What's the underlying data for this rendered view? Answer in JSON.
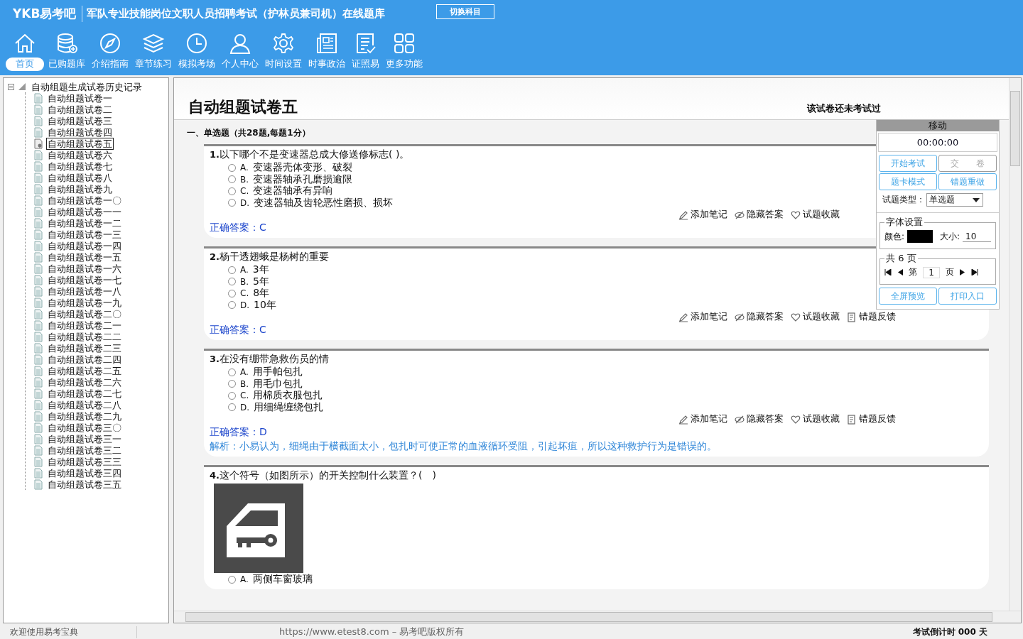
{
  "header": {
    "logo": "YKB易考吧",
    "title": "军队专业技能岗位文职人员招聘考试（护林员兼司机）在线题库",
    "switch_button": "切换科目"
  },
  "toolbar": [
    {
      "label": "首页",
      "selected": true
    },
    {
      "label": "已购题库",
      "selected": false
    },
    {
      "label": "介绍指南",
      "selected": false
    },
    {
      "label": "章节练习",
      "selected": false
    },
    {
      "label": "模拟考场",
      "selected": false
    },
    {
      "label": "个人中心",
      "selected": false
    },
    {
      "label": "时间设置",
      "selected": false
    },
    {
      "label": "时事政治",
      "selected": false
    },
    {
      "label": "证照易",
      "selected": false
    },
    {
      "label": "更多功能",
      "selected": false
    }
  ],
  "tree": {
    "label": "自动组题生成试卷历史记录",
    "expanded": true,
    "children": [
      {
        "label": "自动组题试卷一",
        "selected": false
      },
      {
        "label": "自动组题试卷二",
        "selected": false
      },
      {
        "label": "自动组题试卷三",
        "selected": false
      },
      {
        "label": "自动组题试卷四",
        "selected": false
      },
      {
        "label": "自动组题试卷五",
        "selected": true
      },
      {
        "label": "自动组题试卷六",
        "selected": false
      },
      {
        "label": "自动组题试卷七",
        "selected": false
      },
      {
        "label": "自动组题试卷八",
        "selected": false
      },
      {
        "label": "自动组题试卷九",
        "selected": false
      },
      {
        "label": "自动组题试卷一〇",
        "selected": false
      },
      {
        "label": "自动组题试卷一一",
        "selected": false
      },
      {
        "label": "自动组题试卷一二",
        "selected": false
      },
      {
        "label": "自动组题试卷一三",
        "selected": false
      },
      {
        "label": "自动组题试卷一四",
        "selected": false
      },
      {
        "label": "自动组题试卷一五",
        "selected": false
      },
      {
        "label": "自动组题试卷一六",
        "selected": false
      },
      {
        "label": "自动组题试卷一七",
        "selected": false
      },
      {
        "label": "自动组题试卷一八",
        "selected": false
      },
      {
        "label": "自动组题试卷一九",
        "selected": false
      },
      {
        "label": "自动组题试卷二〇",
        "selected": false
      },
      {
        "label": "自动组题试卷二一",
        "selected": false
      },
      {
        "label": "自动组题试卷二二",
        "selected": false
      },
      {
        "label": "自动组题试卷二三",
        "selected": false
      },
      {
        "label": "自动组题试卷二四",
        "selected": false
      },
      {
        "label": "自动组题试卷二五",
        "selected": false
      },
      {
        "label": "自动组题试卷二六",
        "selected": false
      },
      {
        "label": "自动组题试卷二七",
        "selected": false
      },
      {
        "label": "自动组题试卷二八",
        "selected": false
      },
      {
        "label": "自动组题试卷二九",
        "selected": false
      },
      {
        "label": "自动组题试卷三〇",
        "selected": false
      },
      {
        "label": "自动组题试卷三一",
        "selected": false
      },
      {
        "label": "自动组题试卷三二",
        "selected": false
      },
      {
        "label": "自动组题试卷三三",
        "selected": false
      },
      {
        "label": "自动组题试卷三四",
        "selected": false
      },
      {
        "label": "自动组题试卷三五",
        "selected": false
      }
    ]
  },
  "exam": {
    "title": "自动组题试卷五",
    "status": "该试卷还未考试过",
    "section": "一、单选题（共28题,每题1分）",
    "questions": [
      {
        "number": "1.",
        "kind": "plain",
        "text": "以下哪个不是变速器总成大修送修标志( )。",
        "options": [
          {
            "label": "A.",
            "text": "变速器壳体变形、破裂",
            "selected": false
          },
          {
            "label": "B.",
            "text": "变速器轴承孔磨损逾限",
            "selected": false
          },
          {
            "label": "C.",
            "text": "变速器轴承有异响",
            "selected": false
          },
          {
            "label": "D.",
            "text": "变速器轴及齿轮恶性磨损、损坏",
            "selected": false
          }
        ],
        "actions": [
          {
            "kind": "note",
            "label": "添加笔记"
          },
          {
            "kind": "hide",
            "label": "隐藏答案"
          },
          {
            "kind": "favorite",
            "label": "试题收藏"
          }
        ],
        "answer_label": "正确答案：",
        "answer": "C"
      },
      {
        "number": "2.",
        "kind": "plain",
        "text": "杨干透翅蛾是杨树的重要",
        "options": [
          {
            "label": "A.",
            "text": "3年",
            "selected": false
          },
          {
            "label": "B.",
            "text": "5年",
            "selected": false
          },
          {
            "label": "C.",
            "text": "8年",
            "selected": false
          },
          {
            "label": "D.",
            "text": "10年",
            "selected": false
          }
        ],
        "actions": [
          {
            "kind": "note",
            "label": "添加笔记"
          },
          {
            "kind": "hide",
            "label": "隐藏答案"
          },
          {
            "kind": "favorite",
            "label": "试题收藏"
          },
          {
            "kind": "report",
            "label": "错题反馈"
          }
        ],
        "answer_label": "正确答案：",
        "answer": "C"
      },
      {
        "number": "3.",
        "kind": "plain",
        "text": "在没有绷带急救伤员的情",
        "options": [
          {
            "label": "A.",
            "text": "用手帕包扎",
            "selected": false
          },
          {
            "label": "B.",
            "text": "用毛巾包扎",
            "selected": false
          },
          {
            "label": "C.",
            "text": "用棉质衣服包扎",
            "selected": false
          },
          {
            "label": "D.",
            "text": "用细绳缠绕包扎",
            "selected": false
          }
        ],
        "actions": [
          {
            "kind": "note",
            "label": "添加笔记"
          },
          {
            "kind": "hide",
            "label": "隐藏答案"
          },
          {
            "kind": "favorite",
            "label": "试题收藏"
          },
          {
            "kind": "report",
            "label": "错题反馈"
          }
        ],
        "answer_label": "正确答案：",
        "answer": "D",
        "analysis": "解析：小易认为，细绳由于横截面太小，包扎时可使正常的血液循环受阻，引起坏疽，所以这种救护行为是错误的。"
      },
      {
        "number": "4.",
        "text": "这个符号（如图所示）的开关控制什么装置？(　)",
        "kind": "picture",
        "options": [
          {
            "label": "A.",
            "text": "两侧车窗玻璃",
            "selected": false
          }
        ]
      }
    ]
  },
  "panel": {
    "title": "移动",
    "timer": "00:00:00",
    "buttons": [
      {
        "label": "开始考试",
        "disabled": false
      },
      {
        "label": "交　　卷",
        "disabled": true
      },
      {
        "label": "题卡模式",
        "disabled": false
      },
      {
        "label": "错题重做",
        "disabled": false
      }
    ],
    "type_label": "试题类型：",
    "type_value": "单选题",
    "font_group": "字体设置",
    "color_label": "颜色:",
    "color": "#000000",
    "size_label": "大小:",
    "size": "10",
    "pages_group": "共 6 页",
    "page_prefix": "第",
    "page": "1",
    "page_suffix": "页",
    "bottom_buttons": [
      "全屏预览",
      "打印入口"
    ]
  },
  "status_bar": [
    "欢迎使用易考宝典",
    "https://www.etest8.com – 易考吧版权所有",
    "考试倒计时 000 天"
  ]
}
